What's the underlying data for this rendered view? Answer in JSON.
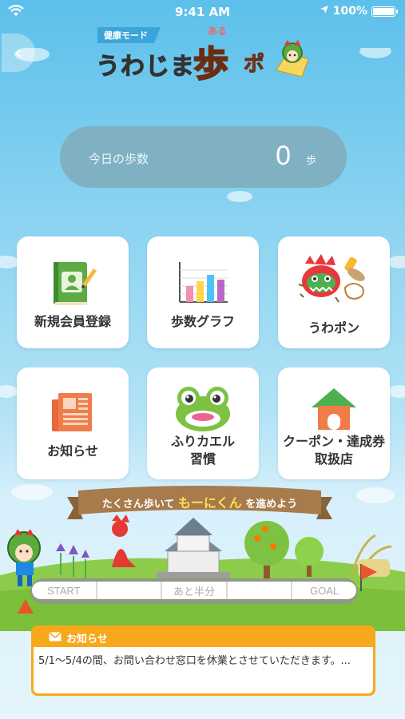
{
  "status_bar": {
    "time": "9:41 AM",
    "battery": "100%"
  },
  "header": {
    "mode_label": "健康モード",
    "logo_text_1": "うわじま",
    "logo_ruby": "ある",
    "logo_text_2": "歩",
    "logo_text_3": "ポ"
  },
  "steps": {
    "label": "今日の歩数",
    "value": "0",
    "unit": "歩"
  },
  "tiles": [
    {
      "label": "新規会員登録"
    },
    {
      "label": "歩数グラフ"
    },
    {
      "label": "うわポン"
    },
    {
      "label": "お知らせ"
    },
    {
      "label": "ふりカエル\n習慣"
    },
    {
      "label": "クーポン・達成券\n取扱店"
    }
  ],
  "banner": {
    "text_before": "たくさん歩いて",
    "highlight": "もーにくん",
    "text_after": "を進めよう"
  },
  "progress": {
    "segments": [
      "START",
      "",
      "あと半分",
      "",
      "GOAL"
    ],
    "level": 0
  },
  "notice": {
    "title": "お知らせ",
    "body": "5/1〜5/4の間、お問い合わせ窓口を休業とさせていただきます。..."
  },
  "colors": {
    "accent": "#f7a81b",
    "pill": "#7fb1c3"
  }
}
